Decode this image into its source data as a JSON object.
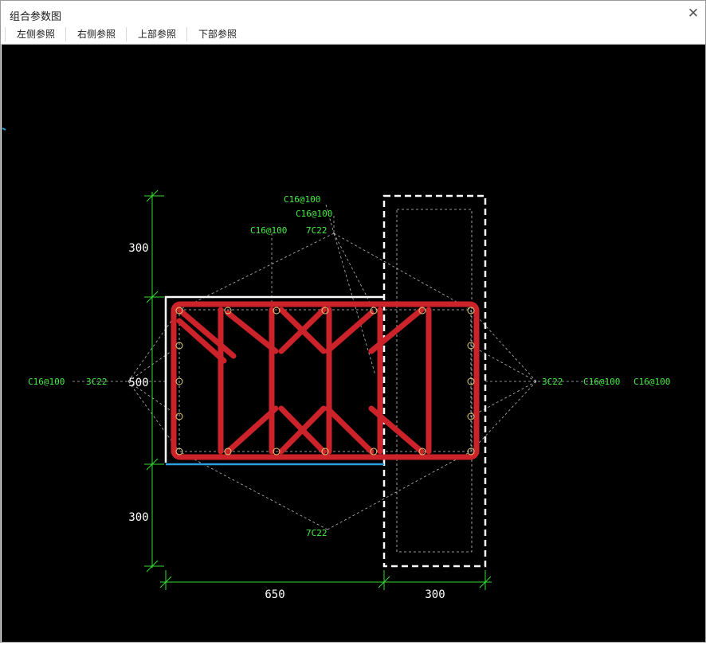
{
  "window": {
    "title": "组合参数图"
  },
  "toolbar": {
    "left_label": "左侧参照",
    "right_label": "右侧参照",
    "top_label": "上部参照",
    "bottom_label": "下部参照"
  },
  "icons": {
    "close": "close-icon"
  },
  "drawing": {
    "dim_left_top": "300",
    "dim_left_mid": "500",
    "dim_left_bottom": "300",
    "dim_bottom_left": "650",
    "dim_bottom_right": "300",
    "top_stirrup_1": "C16@100",
    "top_stirrup_2": "C16@100",
    "top_stirrup_3": "C16@100",
    "top_rebar": "7C22",
    "bottom_rebar": "7C22",
    "left_stirrup": "C16@100",
    "left_rebar": "3C22",
    "right_rebar": "3C22",
    "right_stirrup_1": "C16@100",
    "right_stirrup_2": "C16@100",
    "colors": {
      "background": "#000000",
      "rebar": "#cc2229",
      "dimension": "#33dd33",
      "label": "#44ee44",
      "outline": "#ffffff",
      "edge": "#2aa0e0"
    }
  }
}
